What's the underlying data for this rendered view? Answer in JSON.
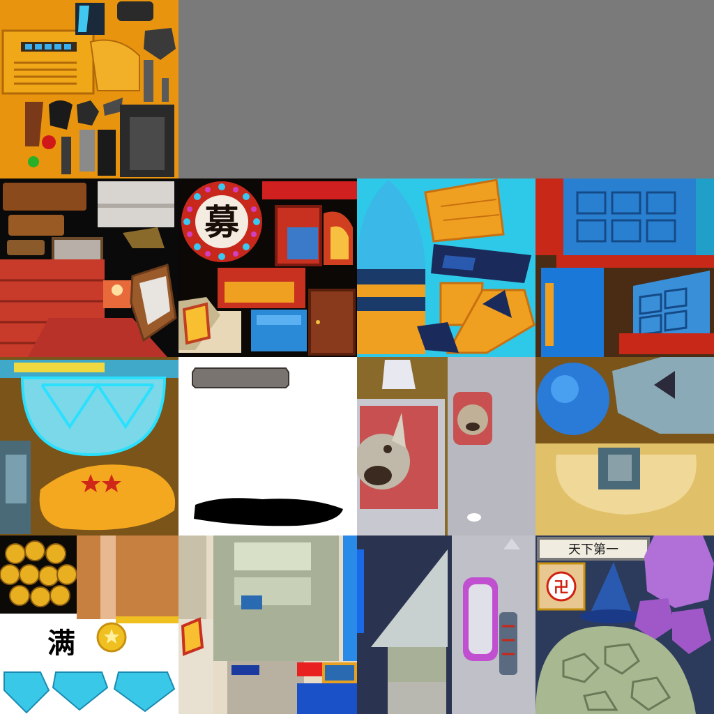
{
  "atlas": {
    "background": "#7a7a7a",
    "tiles": {
      "t00": {
        "bg": "#e8940f"
      },
      "t10": {
        "bg": "#0a0a0a"
      },
      "t11": {
        "bg": "#0c0806",
        "medallion_glyph": "募"
      },
      "t12": {
        "bg": "#2ec8e8"
      },
      "t13": {
        "bg": "#4a2c14"
      },
      "t20": {
        "bg": "#7a5418"
      },
      "t21": {
        "bg": "#ffffff"
      },
      "t22": {
        "bg": "#8a6a2a"
      },
      "t23": {
        "bg": "#7a5418"
      },
      "t30": {
        "bg": "#ffffff",
        "full_glyph": "满"
      },
      "t31": {
        "bg": "#e6dcc8"
      },
      "t32": {
        "bg": "#2a3450"
      },
      "t33": {
        "bg": "#2c3a5c",
        "banner_text": "天下第一",
        "seal_glyph": "卍"
      }
    }
  }
}
